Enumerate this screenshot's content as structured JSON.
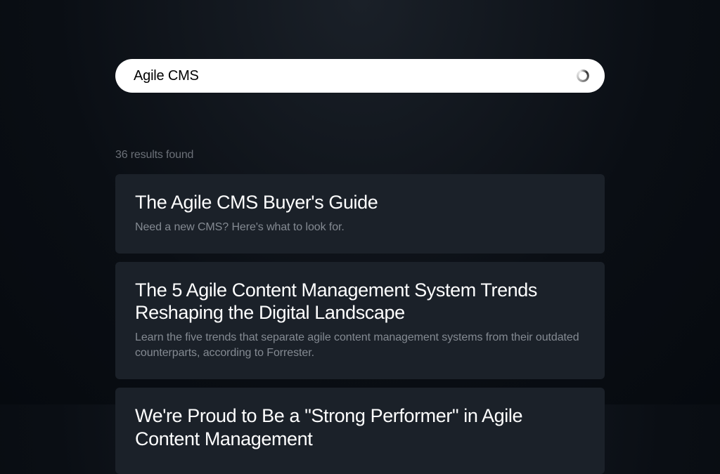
{
  "search": {
    "value": "Agile CMS",
    "placeholder": ""
  },
  "results_meta": "36 results found",
  "results": [
    {
      "title": "The Agile CMS Buyer's Guide",
      "description": "Need a new CMS? Here's what to look for."
    },
    {
      "title": "The 5 Agile Content Management System Trends Reshaping the Digital Landscape",
      "description": "Learn the five trends that separate agile content management systems from their outdated counterparts, according to Forrester."
    },
    {
      "title": "We're Proud to Be a \"Strong Performer\" in Agile Content Management",
      "description": ""
    }
  ]
}
